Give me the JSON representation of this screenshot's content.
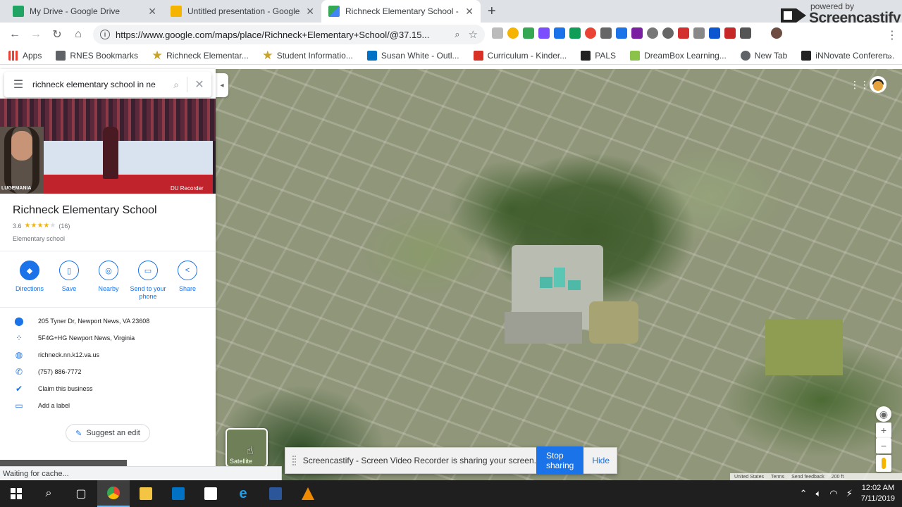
{
  "browser": {
    "tabs": [
      {
        "title": "My Drive - Google Drive",
        "color": "#1fa463",
        "active": false
      },
      {
        "title": "Untitled presentation - Google S",
        "color": "#f4b400",
        "active": false
      },
      {
        "title": "Richneck Elementary School - Go",
        "color": "#34a853",
        "active": true
      }
    ],
    "url": "https://www.google.com/maps/place/Richneck+Elementary+School/@37.15...",
    "bookmarks": [
      {
        "label": "Apps",
        "icon": "apps-icon",
        "color": "#e94235"
      },
      {
        "label": "RNES Bookmarks",
        "icon": "folder-icon",
        "color": "#5f6368"
      },
      {
        "label": "Richneck Elementar...",
        "icon": "star-logo-icon",
        "color": "#c9a227"
      },
      {
        "label": "Student Informatio...",
        "icon": "star-logo-icon",
        "color": "#c9a227"
      },
      {
        "label": "Susan White - Outl...",
        "icon": "outlook-icon",
        "color": "#0072c6"
      },
      {
        "label": "Curriculum - Kinder...",
        "icon": "s-icon",
        "color": "#d93025"
      },
      {
        "label": "PALS",
        "icon": "pals-icon",
        "color": "#222222"
      },
      {
        "label": "DreamBox Learning...",
        "icon": "dreambox-icon",
        "color": "#8bc34a"
      },
      {
        "label": "New Tab",
        "icon": "globe-icon",
        "color": "#5f6368"
      },
      {
        "label": "iNNovate Conferen...",
        "icon": "innovate-icon",
        "color": "#222222"
      }
    ]
  },
  "screencastify_brand": {
    "powered": "powered by",
    "name": "Screencastify"
  },
  "maps": {
    "search_query": "richneck elementary school in ne",
    "place": {
      "name": "Richneck Elementary School",
      "rating": "3.6",
      "rating_value": 3.6,
      "review_count": "(16)",
      "category": "Elementary school"
    },
    "photo_overlay": {
      "caption": "LUGEMANIA",
      "badge": "DU Recorder"
    },
    "actions": [
      {
        "label": "Directions",
        "icon": "directions-icon"
      },
      {
        "label": "Save",
        "icon": "bookmark-icon"
      },
      {
        "label": "Nearby",
        "icon": "nearby-icon"
      },
      {
        "label": "Send to your phone",
        "icon": "send-to-phone-icon"
      },
      {
        "label": "Share",
        "icon": "share-icon"
      }
    ],
    "info": [
      {
        "text": "205 Tyner Dr, Newport News, VA 23608",
        "icon": "location-pin-icon"
      },
      {
        "text": "5F4G+HG Newport News, Virginia",
        "icon": "plus-code-icon"
      },
      {
        "text": "richneck.nn.k12.va.us",
        "icon": "globe-icon"
      },
      {
        "text": "(757) 886-7772",
        "icon": "phone-icon"
      },
      {
        "text": "Claim this business",
        "icon": "verified-icon"
      },
      {
        "text": "Add a label",
        "icon": "label-icon"
      }
    ],
    "suggest_edit": "Suggest an edit",
    "layer_label": "Satellite",
    "footer": [
      "United States",
      "Terms",
      "Send feedback",
      "200 ft"
    ]
  },
  "screencastify_bar": {
    "message": "Screencastify - Screen Video Recorder is sharing your screen.",
    "stop": "Stop sharing",
    "hide": "Hide"
  },
  "status": "Waiting for cache...",
  "taskbar": {
    "time": "12:02 AM",
    "date": "7/11/2019"
  }
}
